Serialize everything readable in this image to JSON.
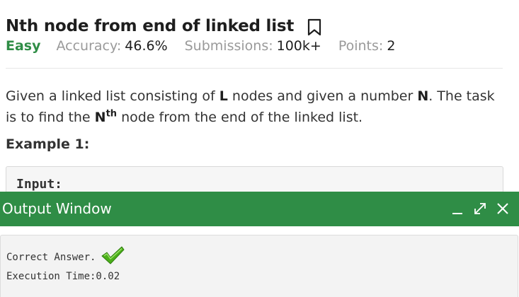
{
  "problem": {
    "title": "Nth node from end of linked list",
    "difficulty": "Easy",
    "stats": {
      "accuracy_label": "Accuracy:",
      "accuracy_value": "46.6%",
      "submissions_label": "Submissions:",
      "submissions_value": "100k+",
      "points_label": "Points:",
      "points_value": "2"
    },
    "description": {
      "part1": "Given a linked list consisting of ",
      "var_l": "L",
      "part2": " nodes and given a number ",
      "var_n": "N",
      "part3": ". The task is to find the ",
      "var_n2": "N",
      "sup": "th",
      "part4": " node from the end of the linked list."
    },
    "example_heading": "Example 1:",
    "example_input_label": "Input:"
  },
  "output_window": {
    "title": "Output Window",
    "result_text": "Correct Answer.",
    "execution_time": "Execution Time:0.02"
  },
  "icons": {
    "bookmark": "bookmark-icon",
    "minimize": "minimize-icon",
    "expand": "expand-icon",
    "close": "close-icon",
    "correct": "check-icon"
  },
  "colors": {
    "brand_green": "#2f8d46",
    "check_green": "#4caf1a",
    "muted_text": "#9a9a9a",
    "body_text": "#333333"
  }
}
